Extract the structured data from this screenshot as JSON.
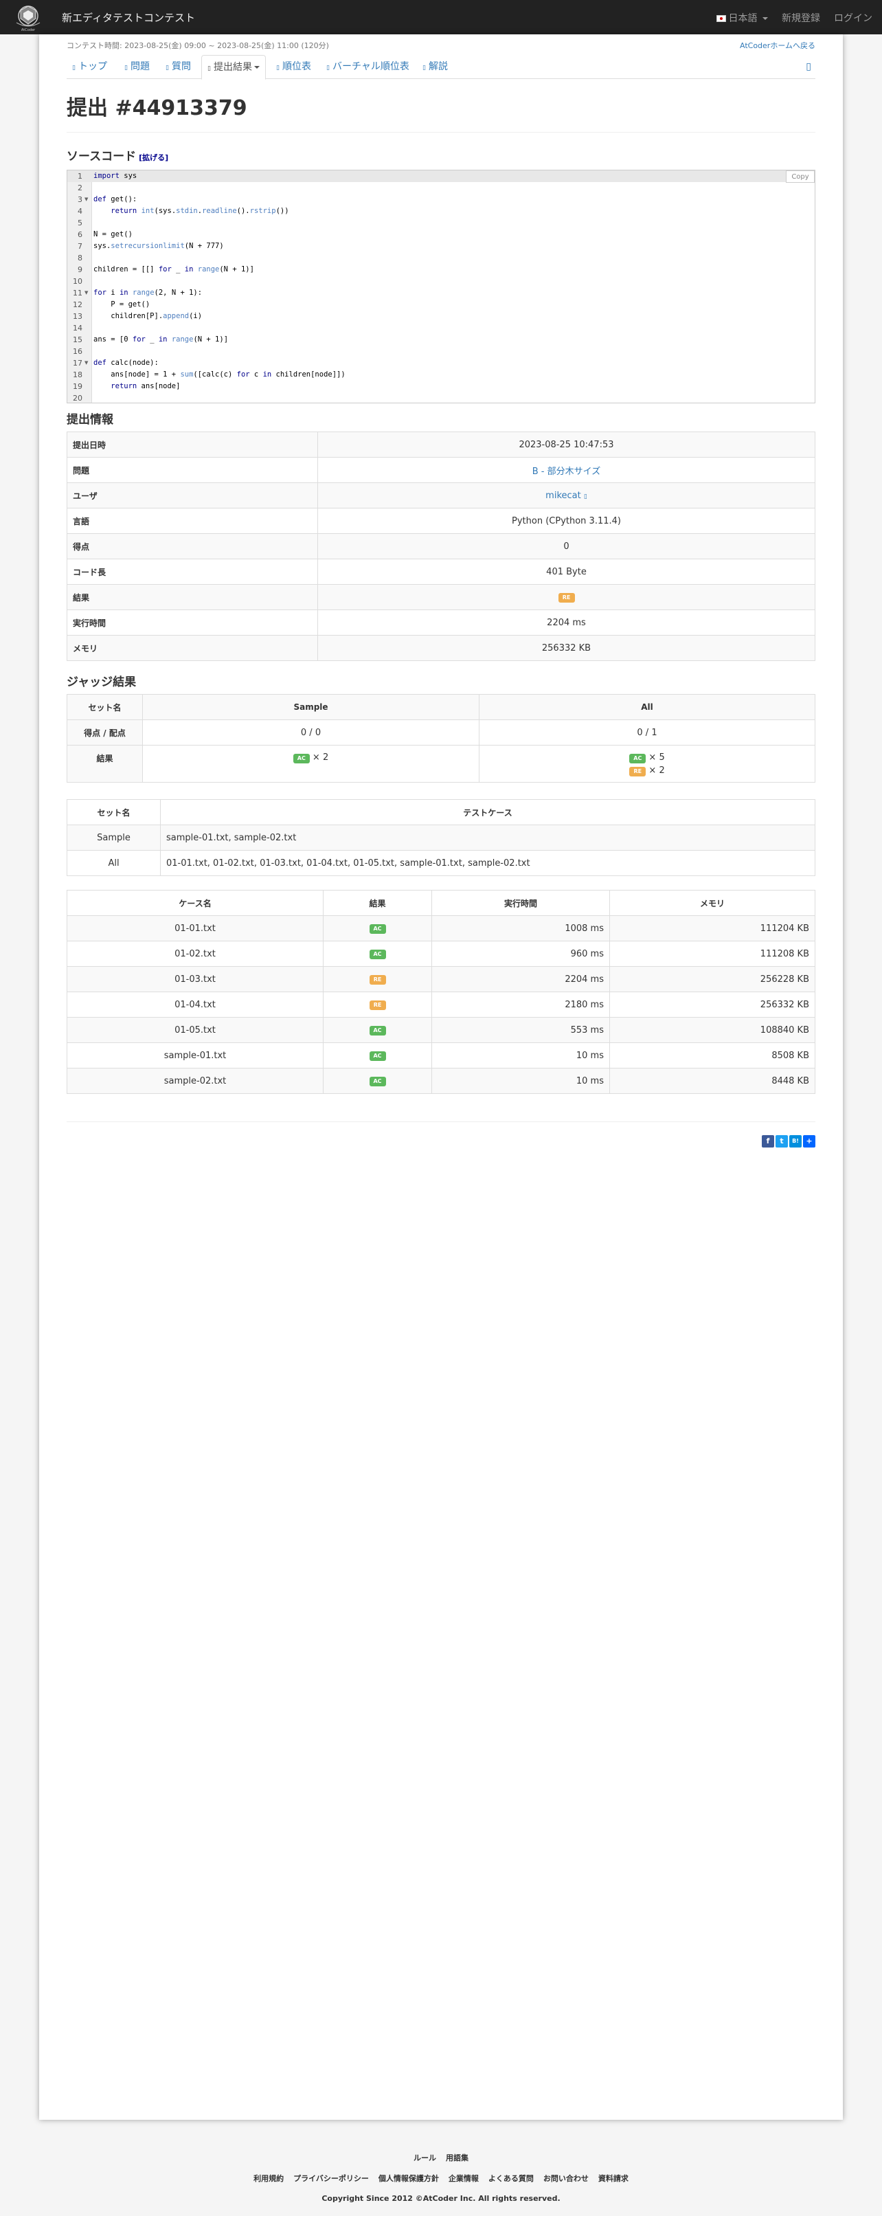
{
  "nav": {
    "brand": "新エディタテストコンテスト",
    "logo_text": "AtCoder",
    "language": "日本語",
    "signup": "新規登録",
    "login": "ログイン"
  },
  "contest": {
    "time": "コンテスト時間: 2023-08-25(金) 09:00 ~ 2023-08-25(金) 11:00 (120分)",
    "home_link": "AtCoderホームへ戻る"
  },
  "tabs": [
    {
      "label": "トップ"
    },
    {
      "label": "問題"
    },
    {
      "label": "質問"
    },
    {
      "label": "提出結果"
    },
    {
      "label": "順位表"
    },
    {
      "label": "バーチャル順位表"
    },
    {
      "label": "解説"
    }
  ],
  "title": "提出 #44913379",
  "source": {
    "heading": "ソースコード",
    "expand": "[拡げる]",
    "copy": "Copy",
    "lines": [
      "import sys",
      "",
      "def get():",
      "    return int(sys.stdin.readline().rstrip())",
      "",
      "N = get()",
      "sys.setrecursionlimit(N + 777)",
      "",
      "children = [[] for _ in range(N + 1)]",
      "",
      "for i in range(2, N + 1):",
      "    P = get()",
      "    children[P].append(i)",
      "",
      "ans = [0 for _ in range(N + 1)]",
      "",
      "def calc(node):",
      "    ans[node] = 1 + sum([calc(c) for c in children[node]])",
      "    return ans[node]",
      ""
    ]
  },
  "info": {
    "heading": "提出情報",
    "rows": [
      {
        "label": "提出日時",
        "value": "2023-08-25 10:47:53"
      },
      {
        "label": "問題",
        "value": "B - 部分木サイズ"
      },
      {
        "label": "ユーザ",
        "value": "mikecat"
      },
      {
        "label": "言語",
        "value": "Python (CPython 3.11.4)"
      },
      {
        "label": "得点",
        "value": "0"
      },
      {
        "label": "コード長",
        "value": "401 Byte"
      },
      {
        "label": "結果",
        "value": "RE"
      },
      {
        "label": "実行時間",
        "value": "2204 ms"
      },
      {
        "label": "メモリ",
        "value": "256332 KB"
      }
    ]
  },
  "judge": {
    "heading": "ジャッジ結果",
    "col_set": "セット名",
    "col_sample": "Sample",
    "col_all": "All",
    "row_score": "得点 / 配点",
    "sample_score": "0 / 0",
    "all_score": "0 / 1",
    "row_result": "結果",
    "sample_ac": "AC",
    "sample_ac_count": "× 2",
    "all_ac": "AC",
    "all_ac_count": "× 5",
    "all_re": "RE",
    "all_re_count": "× 2"
  },
  "sets": {
    "col_set": "セット名",
    "col_cases": "テストケース",
    "rows": [
      {
        "name": "Sample",
        "cases": "sample-01.txt, sample-02.txt"
      },
      {
        "name": "All",
        "cases": "01-01.txt, 01-02.txt, 01-03.txt, 01-04.txt, 01-05.txt, sample-01.txt, sample-02.txt"
      }
    ]
  },
  "cases": {
    "col_name": "ケース名",
    "col_status": "結果",
    "col_time": "実行時間",
    "col_mem": "メモリ",
    "rows": [
      {
        "name": "01-01.txt",
        "status": "AC",
        "time": "1008 ms",
        "mem": "111204 KB"
      },
      {
        "name": "01-02.txt",
        "status": "AC",
        "time": "960 ms",
        "mem": "111208 KB"
      },
      {
        "name": "01-03.txt",
        "status": "RE",
        "time": "2204 ms",
        "mem": "256228 KB"
      },
      {
        "name": "01-04.txt",
        "status": "RE",
        "time": "2180 ms",
        "mem": "256332 KB"
      },
      {
        "name": "01-05.txt",
        "status": "AC",
        "time": "553 ms",
        "mem": "108840 KB"
      },
      {
        "name": "sample-01.txt",
        "status": "AC",
        "time": "10 ms",
        "mem": "8508 KB"
      },
      {
        "name": "sample-02.txt",
        "status": "AC",
        "time": "10 ms",
        "mem": "8448 KB"
      }
    ]
  },
  "share": {
    "fb": "f",
    "tw": "t",
    "hb": "B!",
    "plus": "+"
  },
  "footer": {
    "row1": [
      "ルール",
      "用語集"
    ],
    "row2": [
      "利用規約",
      "プライバシーポリシー",
      "個人情報保護方針",
      "企業情報",
      "よくある質問",
      "お問い合わせ",
      "資料請求"
    ],
    "copyright": "Copyright Since 2012 ©AtCoder Inc. All rights reserved."
  },
  "colors": {
    "ac": "#5cb85c",
    "re": "#f0ad4e",
    "link": "#337ab7",
    "navbar": "#222222"
  }
}
